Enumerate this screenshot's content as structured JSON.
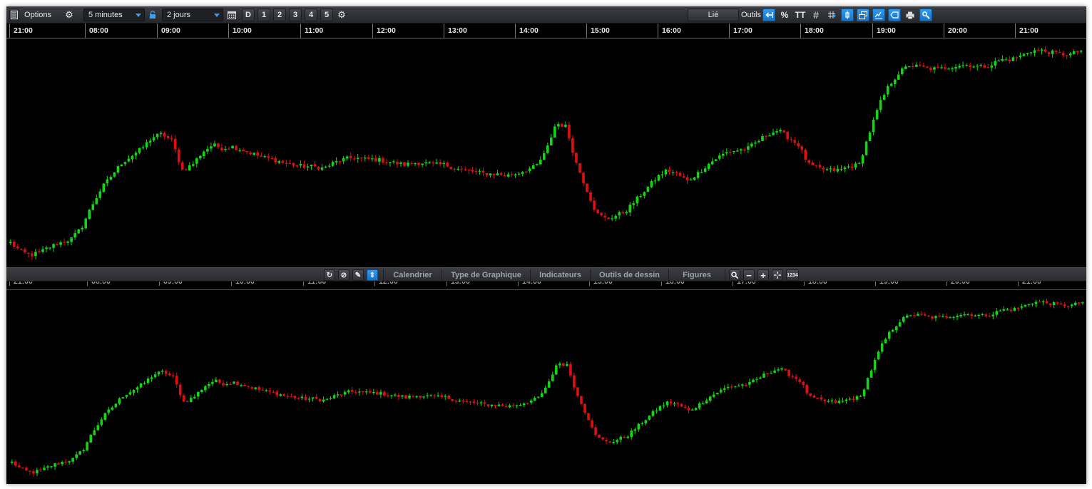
{
  "toolbar": {
    "options_label": "Options",
    "interval": "5 minutes",
    "period": "2 jours",
    "day_label": "D",
    "layout_buttons": [
      "1",
      "2",
      "3",
      "4",
      "5"
    ],
    "linked_label": "Lié",
    "tools_label": "Outils",
    "percent_label": "%",
    "text_label": "TT"
  },
  "time_axis": [
    "21:00",
    "08:00",
    "09:00",
    "10:00",
    "11:00",
    "12:00",
    "13:00",
    "14:00",
    "15:00",
    "16:00",
    "17:00",
    "18:00",
    "19:00",
    "20:00",
    "21:00"
  ],
  "bottom_menu": {
    "calendar": "Calendrier",
    "chart_type": "Type de Graphique",
    "indicators": "Indicateurs",
    "drawing_tools": "Outils de dessin",
    "figures": "Figures",
    "digits_label": "1234"
  },
  "colors": {
    "bullish": "#12d612",
    "bearish": "#e00f0f",
    "background": "#000000",
    "accent": "#1e88e5"
  },
  "chart_data": {
    "type": "candlestick",
    "price_path": [
      20,
      15,
      13,
      15,
      18,
      20,
      22,
      28,
      40,
      50,
      57,
      64,
      68,
      72,
      78,
      80,
      76,
      60,
      63,
      70,
      74,
      72,
      73,
      71,
      69,
      67,
      66,
      64,
      63,
      62,
      62,
      61,
      64,
      66,
      67,
      66,
      66,
      65,
      64,
      63,
      64,
      64,
      63,
      63,
      61,
      60,
      59,
      58,
      58,
      57,
      58,
      60,
      62,
      70,
      86,
      84,
      64,
      50,
      36,
      33,
      35,
      38,
      44,
      50,
      56,
      60,
      58,
      54,
      58,
      63,
      67,
      70,
      71,
      72,
      76,
      80,
      82,
      78,
      74,
      63,
      61,
      60,
      60,
      62,
      63,
      80,
      96,
      107,
      114,
      118,
      117,
      116,
      116,
      117,
      118,
      118,
      117,
      118,
      121,
      121,
      123,
      126,
      126,
      125,
      124,
      124,
      126
    ]
  }
}
